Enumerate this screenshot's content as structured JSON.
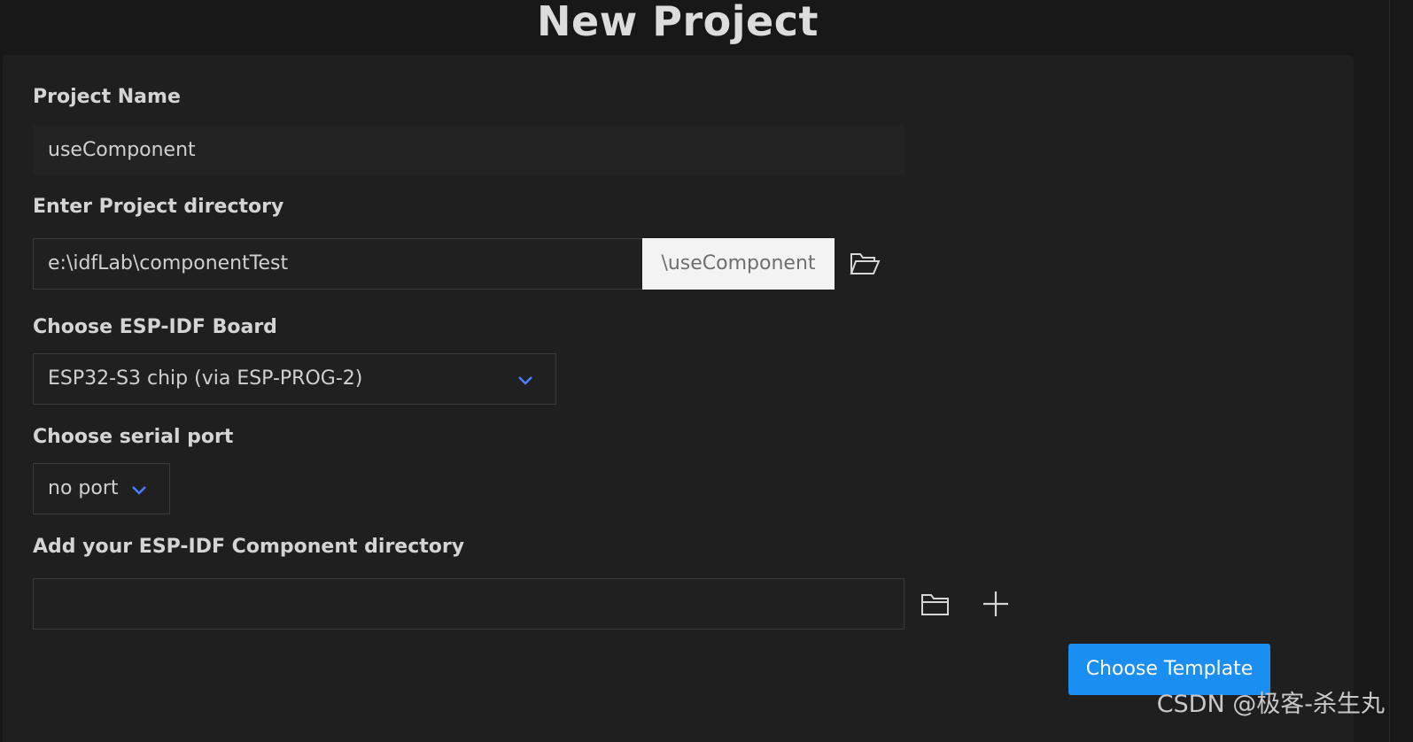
{
  "header": {
    "title": "New Project"
  },
  "form": {
    "project_name": {
      "label": "Project Name",
      "value": "useComponent"
    },
    "project_directory": {
      "label": "Enter Project directory",
      "value": "e:\\idfLab\\componentTest",
      "suffix": "\\useComponent",
      "browse_icon": "folder-open-icon"
    },
    "board": {
      "label": "Choose ESP-IDF Board",
      "selected": "ESP32-S3 chip (via ESP-PROG-2)",
      "icon": "chevron-down-icon"
    },
    "serial_port": {
      "label": "Choose serial port",
      "selected": "no port",
      "icon": "chevron-down-icon"
    },
    "component_directory": {
      "label": "Add your ESP-IDF Component directory",
      "value": "",
      "browse_icon": "folder-icon",
      "add_icon": "plus-icon"
    }
  },
  "actions": {
    "choose_template_label": "Choose Template"
  },
  "watermark": {
    "text": "CSDN @极客-杀生丸"
  },
  "colors": {
    "background": "#181818",
    "panel": "#1f1f1f",
    "accent": "#1b8ef2",
    "chevron": "#4a7dff"
  }
}
